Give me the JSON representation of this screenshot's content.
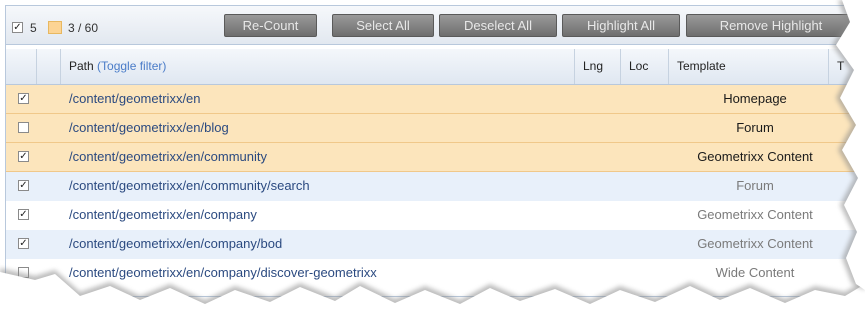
{
  "toolbar": {
    "selected_count": "5",
    "highlight_count": "3 / 60",
    "buttons": [
      "Re-Count",
      "Select All",
      "Deselect All",
      "Highlight All",
      "Remove Highlight"
    ]
  },
  "columns": {
    "path": "Path",
    "path_toggle": "(Toggle filter)",
    "lng": "Lng",
    "loc": "Loc",
    "template": "Template",
    "extra": "T"
  },
  "rows": [
    {
      "path": "/content/geometrixx/en",
      "template": "Homepage",
      "checked": true,
      "highlighted": true
    },
    {
      "path": "/content/geometrixx/en/blog",
      "template": "Forum",
      "checked": false,
      "highlighted": true
    },
    {
      "path": "/content/geometrixx/en/community",
      "template": "Geometrixx Content",
      "checked": true,
      "highlighted": true
    },
    {
      "path": "/content/geometrixx/en/community/search",
      "template": "Forum",
      "checked": true,
      "highlighted": false
    },
    {
      "path": "/content/geometrixx/en/company",
      "template": "Geometrixx Content",
      "checked": true,
      "highlighted": false
    },
    {
      "path": "/content/geometrixx/en/company/bod",
      "template": "Geometrixx Content",
      "checked": true,
      "highlighted": false
    },
    {
      "path": "/content/geometrixx/en/company/discover-geometrixx",
      "template": "Wide Content",
      "checked": false,
      "highlighted": false
    }
  ],
  "colors": {
    "highlight_row": "#fce5bc",
    "alt_row": "#e8f0fa",
    "link": "#2b4a80",
    "toggle_link": "#4a7cc8",
    "button": "#7e7e7e"
  }
}
